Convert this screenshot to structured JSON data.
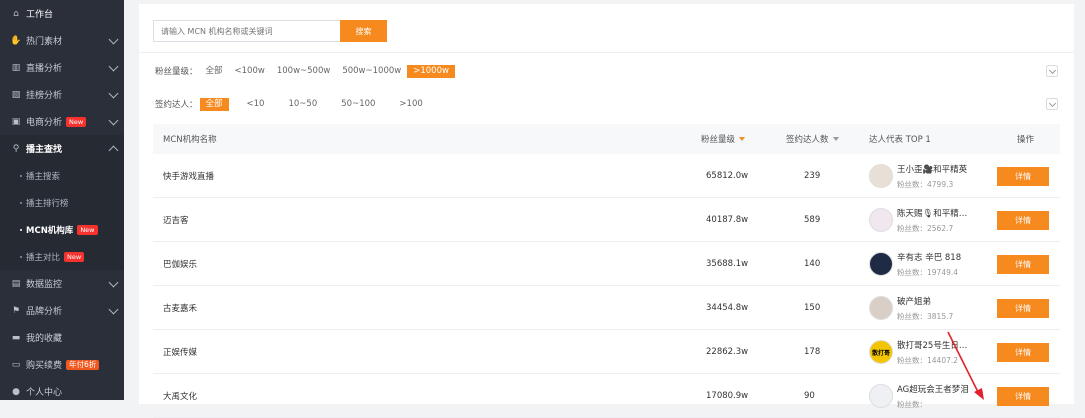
{
  "sidebar": {
    "items": [
      {
        "label": "工作台",
        "icon": "home-icon",
        "glyph": "⌂"
      },
      {
        "label": "热门素材",
        "icon": "hand-icon",
        "glyph": "✋"
      },
      {
        "label": "直播分析",
        "icon": "live-chart-icon",
        "glyph": "▥"
      },
      {
        "label": "挂榜分析",
        "icon": "trend-icon",
        "glyph": "▧"
      },
      {
        "label": "电商分析",
        "icon": "shop-icon",
        "glyph": "▣",
        "badge": "New"
      },
      {
        "label": "播主查找",
        "icon": "search-icon",
        "glyph": "⚲"
      }
    ],
    "subitems": [
      {
        "label": "播主搜索"
      },
      {
        "label": "播主排行榜"
      },
      {
        "label": "MCN机构库",
        "badge": "New"
      },
      {
        "label": "播主对比",
        "badge": "New"
      }
    ],
    "bottom": [
      {
        "label": "数据监控",
        "icon": "monitor-icon",
        "glyph": "▤"
      },
      {
        "label": "品牌分析",
        "icon": "brand-icon",
        "glyph": "⚑"
      },
      {
        "label": "我的收藏",
        "icon": "folder-icon",
        "glyph": "▬"
      },
      {
        "label": "购买续费",
        "icon": "cart-icon",
        "glyph": "▭",
        "badge": "年付6折"
      },
      {
        "label": "个人中心",
        "icon": "user-icon",
        "glyph": "●"
      }
    ]
  },
  "search": {
    "placeholder": "请输入 MCN 机构名称或关键词",
    "button": "搜索"
  },
  "filters": {
    "fans": {
      "label": "粉丝量级：",
      "options": [
        "全部",
        "<100w",
        "100w~500w",
        "500w~1000w",
        ">1000w"
      ],
      "selected": 4
    },
    "signed": {
      "label": "签约达人：",
      "options": [
        "全部",
        "<10",
        "10~50",
        "50~100",
        ">100"
      ],
      "selected": 0
    }
  },
  "table": {
    "headers": {
      "name": "MCN机构名称",
      "fans": "粉丝量级",
      "signed": "签约达人数",
      "top": "达人代表 TOP 1",
      "op": "操作"
    },
    "rows": [
      {
        "name": "快手游戏直播",
        "fans": "65812.0w",
        "signed": "239",
        "kol": "王小歪🎥和平精英",
        "kol_fans": "粉丝数：4799.3",
        "btn": "详情",
        "avatar_color": "#e8e0d6",
        "avatar_text": ""
      },
      {
        "name": "迈吉客",
        "fans": "40187.8w",
        "signed": "589",
        "kol": "陈天赐🎙和平精英…",
        "kol_fans": "粉丝数：2562.7",
        "btn": "详情",
        "avatar_color": "#f1e7ef",
        "avatar_text": ""
      },
      {
        "name": "巴伽娱乐",
        "fans": "35688.1w",
        "signed": "140",
        "kol": "辛有志 辛巴 818",
        "kol_fans": "粉丝数：19749.4",
        "btn": "详情",
        "avatar_color": "#1f2a44",
        "avatar_text": ""
      },
      {
        "name": "古麦嘉禾",
        "fans": "34454.8w",
        "signed": "150",
        "kol": "破产姐弟",
        "kol_fans": "粉丝数：3815.7",
        "btn": "详情",
        "avatar_color": "#d9cfc6",
        "avatar_text": ""
      },
      {
        "name": "正娱传媒",
        "fans": "22862.3w",
        "signed": "178",
        "kol": "散打哥25号生日会…",
        "kol_fans": "粉丝数：14407.2",
        "btn": "详情",
        "avatar_color": "#f3c400",
        "avatar_text": "散打哥"
      },
      {
        "name": "大禹文化",
        "fans": "17080.9w",
        "signed": "90",
        "kol": "AG超玩会王者梦泪",
        "kol_fans": "粉丝数：",
        "btn": "详情",
        "avatar_color": "#eef0f3",
        "avatar_text": ""
      }
    ]
  },
  "colors": {
    "accent": "#f68a1e",
    "sidebar_bg": "#2b2f3a",
    "arrow": "#e3202a"
  }
}
